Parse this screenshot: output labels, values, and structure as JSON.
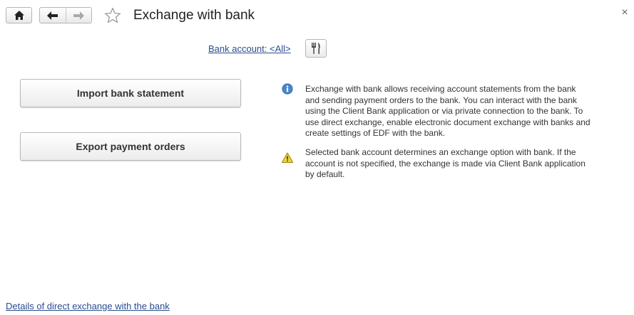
{
  "window": {
    "title": "Exchange with bank",
    "close_glyph": "×"
  },
  "toolbar": {
    "home_icon": "home-icon",
    "back_icon": "arrow-left-icon",
    "forward_icon": "arrow-right-icon",
    "favorite_icon": "star-icon"
  },
  "filter": {
    "bank_account_label": "Bank account: <All>",
    "settings_icon": "settings-icon"
  },
  "actions": {
    "import_label": "Import bank statement",
    "export_label": "Export payment orders"
  },
  "notes": {
    "info_text": "Exchange with bank allows receiving account statements from the bank and sending payment orders to the bank. You can interact with the bank using the Client Bank application or via private connection to the bank. To use direct exchange, enable electronic document exchange with banks and create settings of EDF with the bank.",
    "warning_text": "Selected bank account determines an exchange option with bank. If the account is not specified, the exchange is made via Client Bank application by default."
  },
  "footer": {
    "details_link": "Details of direct exchange with the bank"
  },
  "colors": {
    "link": "#2a4d8f",
    "info_icon": "#4a86c8",
    "warning_icon": "#f5d328"
  }
}
